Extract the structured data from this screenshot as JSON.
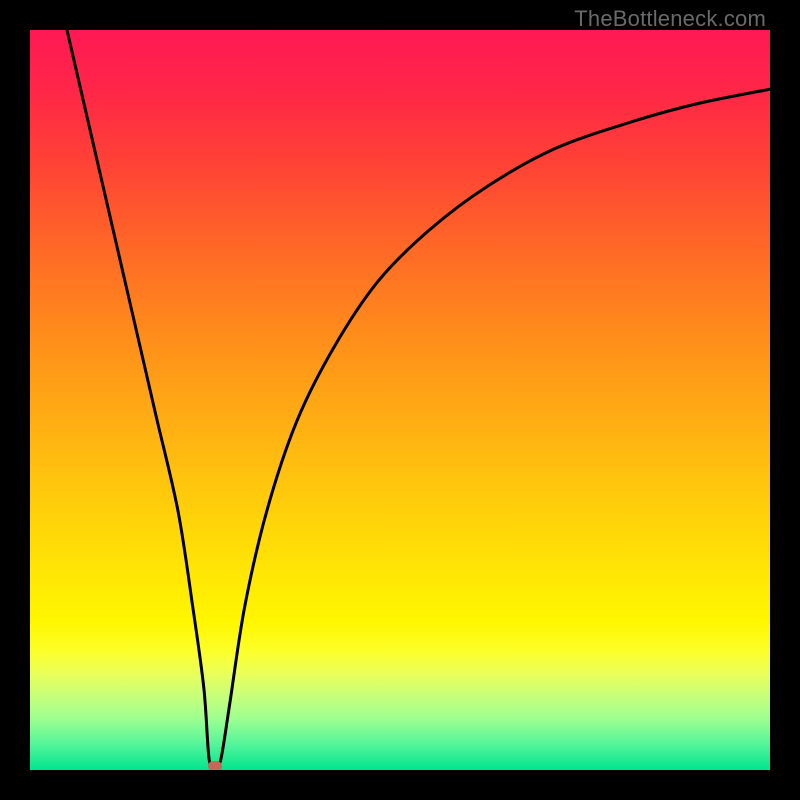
{
  "watermark": "TheBottleneck.com",
  "colors": {
    "black": "#000000",
    "curve": "#000000",
    "marker": "#c26a5a",
    "gradient_stops": [
      {
        "offset": 0.0,
        "color": "#ff1954"
      },
      {
        "offset": 0.08,
        "color": "#ff2648"
      },
      {
        "offset": 0.18,
        "color": "#ff4236"
      },
      {
        "offset": 0.3,
        "color": "#ff6a26"
      },
      {
        "offset": 0.42,
        "color": "#ff8f1a"
      },
      {
        "offset": 0.55,
        "color": "#ffb412"
      },
      {
        "offset": 0.68,
        "color": "#ffd808"
      },
      {
        "offset": 0.8,
        "color": "#fff700"
      },
      {
        "offset": 0.84,
        "color": "#fcff2a"
      },
      {
        "offset": 0.87,
        "color": "#e9ff5a"
      },
      {
        "offset": 0.9,
        "color": "#c7ff7a"
      },
      {
        "offset": 0.93,
        "color": "#9eff90"
      },
      {
        "offset": 0.965,
        "color": "#55f59a"
      },
      {
        "offset": 1.0,
        "color": "#00e58f"
      }
    ]
  },
  "chart_data": {
    "type": "line",
    "title": "",
    "xlabel": "",
    "ylabel": "",
    "xlim": [
      0,
      100
    ],
    "ylim": [
      0,
      100
    ],
    "grid": false,
    "series": [
      {
        "name": "curve",
        "x": [
          5,
          8,
          11,
          14,
          17,
          20,
          22,
          23.5,
          24.2,
          25,
          25.8,
          27,
          29,
          32,
          36,
          41,
          47,
          54,
          62,
          71,
          81,
          90,
          100
        ],
        "y": [
          100,
          87,
          74,
          61,
          48,
          35,
          22,
          11,
          1.5,
          0.5,
          1.5,
          9,
          22,
          35,
          47,
          57,
          66,
          73,
          79,
          84,
          87.5,
          90,
          92
        ]
      }
    ],
    "marker_point": {
      "x": 25,
      "y": 0.5
    },
    "annotations": []
  }
}
